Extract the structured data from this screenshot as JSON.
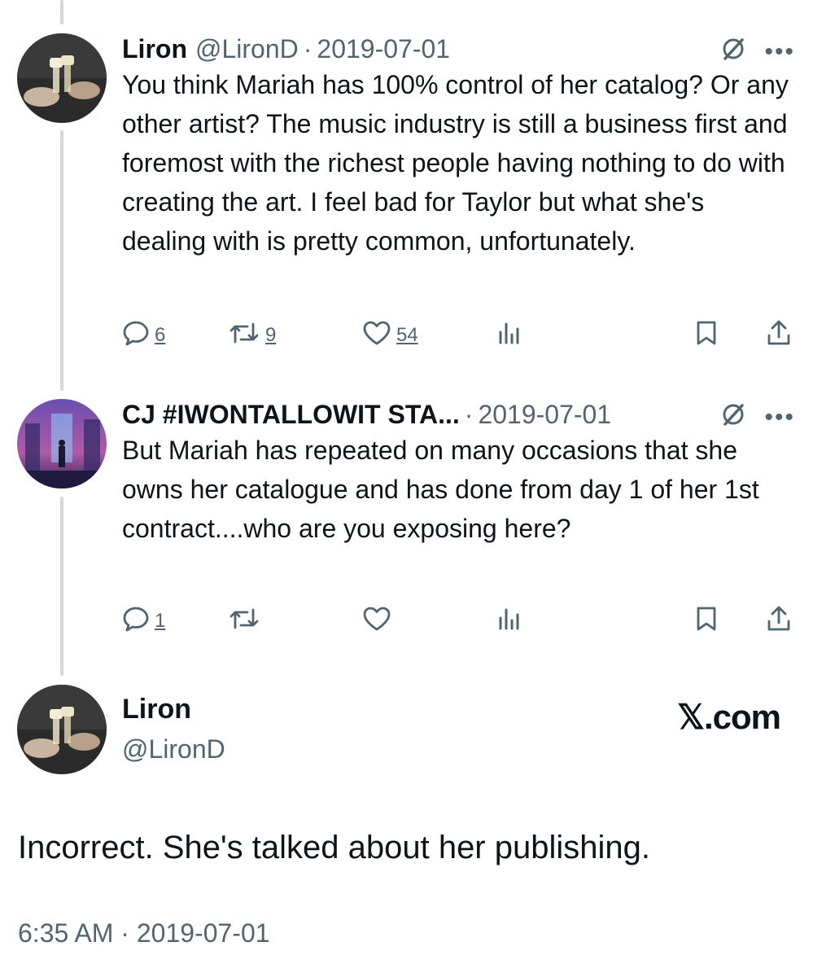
{
  "tweets": [
    {
      "name": "Liron",
      "handle": "@LironD",
      "separator": "·",
      "date": "2019-07-01",
      "text": "You think Mariah has 100% control of her catalog? Or any other artist? The music industry is still a business first and foremost with the richest people having nothing to do with creating the art. I feel bad for Taylor but what she's dealing with is pretty common, unfortunately.",
      "replies": "6",
      "retweets": "9",
      "likes": "54"
    },
    {
      "name": "CJ #IWONTALLOWIT STA...",
      "separator": "·",
      "date": "2019-07-01",
      "text": "But Mariah has repeated on many occasions that she owns her catalogue and has done from day 1 of her 1st contract....who are you exposing here?",
      "replies": "1",
      "retweets": "",
      "likes": ""
    }
  ],
  "main_tweet": {
    "name": "Liron",
    "handle": "@LironD",
    "brand": "𝕏.com",
    "text": "Incorrect. She's talked about her publishing.",
    "timestamp": "6:35 AM · 2019-07-01"
  },
  "icons": [
    "reply-icon",
    "retweet-icon",
    "like-icon",
    "views-icon",
    "bookmark-icon",
    "share-icon",
    "grok-icon",
    "more-icon"
  ],
  "colors": {
    "text": "#0f1419",
    "secondary": "#536471",
    "thread_line": "#cfd9de"
  }
}
